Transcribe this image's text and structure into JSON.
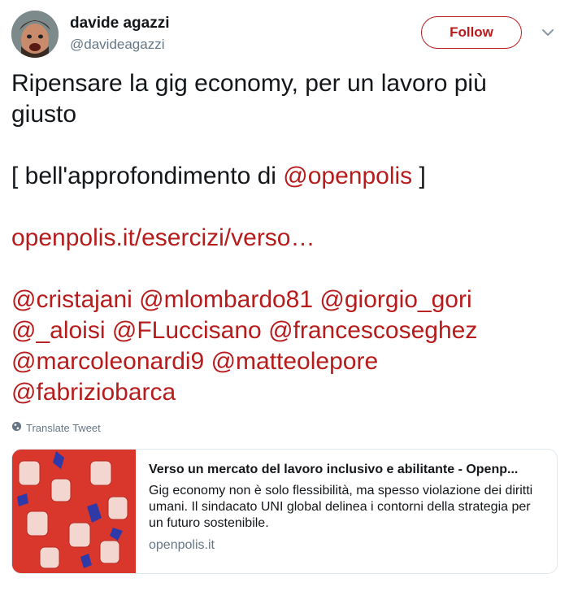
{
  "user": {
    "name": "davide agazzi",
    "handle": "@davideagazzi",
    "follow_label": "Follow"
  },
  "tweet": {
    "line1": "Ripensare la gig economy, per un lavoro più giusto",
    "line2_prefix": "[ bell'approfondimento di ",
    "line2_mention": "@openpolis",
    "line2_suffix": " ]",
    "link": "openpolis.it/esercizi/verso…",
    "mentions": [
      "@cristajani",
      "@mlombardo81",
      "@giorgio_gori",
      "@_aloisi",
      "@FLuccisano",
      "@francescoseghez",
      "@marcoleonardi9",
      "@matteolepore",
      "@fabriziobarca"
    ]
  },
  "translate_label": "Translate Tweet",
  "card": {
    "title": "Verso un mercato del lavoro inclusivo e abilitante - Openp...",
    "description": "Gig economy non è solo flessibilità, ma spesso violazione dei diritti umani. Il sindacato UNI global delinea i contorni della strategia per un futuro sostenibile.",
    "domain": "openpolis.it"
  },
  "colors": {
    "accent": "#b71c1c",
    "secondary_text": "#657786",
    "card_image_bg": "#d9362c"
  }
}
